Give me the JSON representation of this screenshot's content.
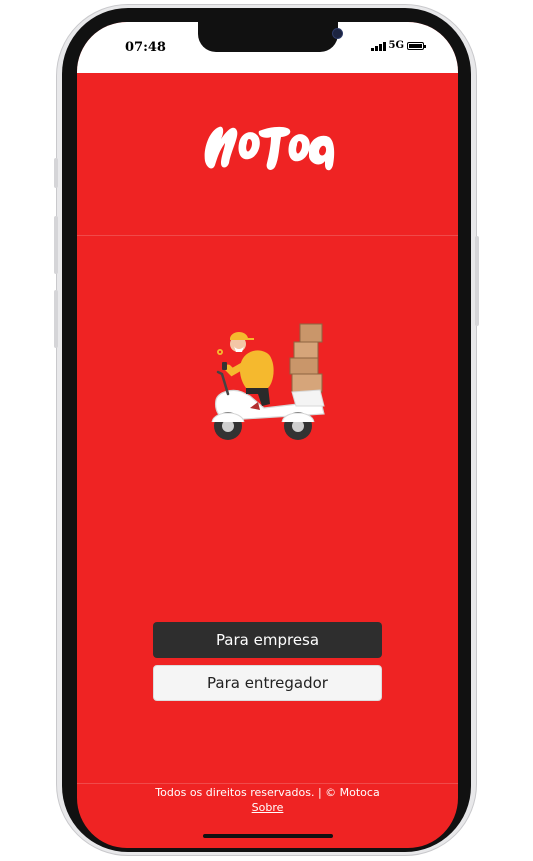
{
  "status_bar": {
    "time": "07:48",
    "network": "5G"
  },
  "brand": {
    "logo_text": "Motoca",
    "primary_color": "#ef2323"
  },
  "hero": {
    "image": "delivery-scooter-illustration"
  },
  "actions": {
    "business_label": "Para empresa",
    "courier_label": "Para entregador"
  },
  "footer": {
    "copyright": "Todos os direitos reservados. | © Motoca",
    "about_link": "Sobre"
  }
}
